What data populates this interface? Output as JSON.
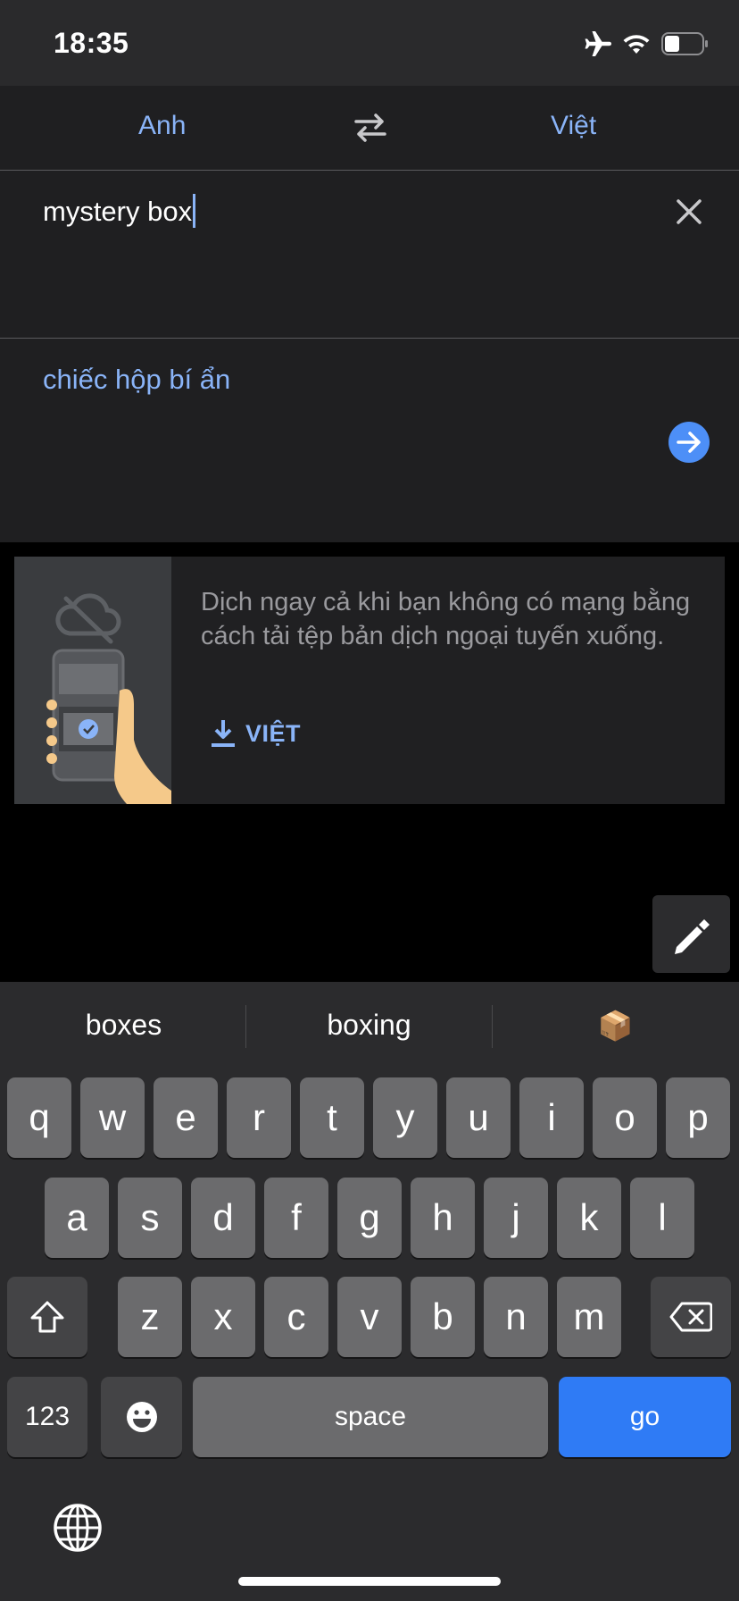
{
  "status": {
    "time": "18:35"
  },
  "languages": {
    "source": "Anh",
    "target": "Việt"
  },
  "input": {
    "text": "mystery box"
  },
  "output": {
    "text": "chiếc hộp bí ẩn"
  },
  "offline_card": {
    "message": "Dịch ngay cả khi bạn không có mạng bằng cách tải tệp bản dịch ngoại tuyến xuống.",
    "download_label": "VIỆT"
  },
  "keyboard": {
    "suggestions": [
      "boxes",
      "boxing",
      "📦"
    ],
    "row1": [
      "q",
      "w",
      "e",
      "r",
      "t",
      "y",
      "u",
      "i",
      "o",
      "p"
    ],
    "row2": [
      "a",
      "s",
      "d",
      "f",
      "g",
      "h",
      "j",
      "k",
      "l"
    ],
    "row3": [
      "z",
      "x",
      "c",
      "v",
      "b",
      "n",
      "m"
    ],
    "numbers_label": "123",
    "space_label": "space",
    "go_label": "go"
  },
  "icons": {
    "airplane": "airplane-icon",
    "wifi": "wifi-icon",
    "battery": "battery-icon",
    "swap": "swap-icon",
    "clear": "close-icon",
    "arrow": "arrow-right-icon",
    "download": "download-icon",
    "pen": "pen-icon",
    "shift": "shift-icon",
    "backspace": "backspace-icon",
    "emoji": "emoji-icon",
    "globe": "globe-icon"
  },
  "colors": {
    "accent": "#8ab4f8",
    "go_button": "#2f7bf5"
  }
}
